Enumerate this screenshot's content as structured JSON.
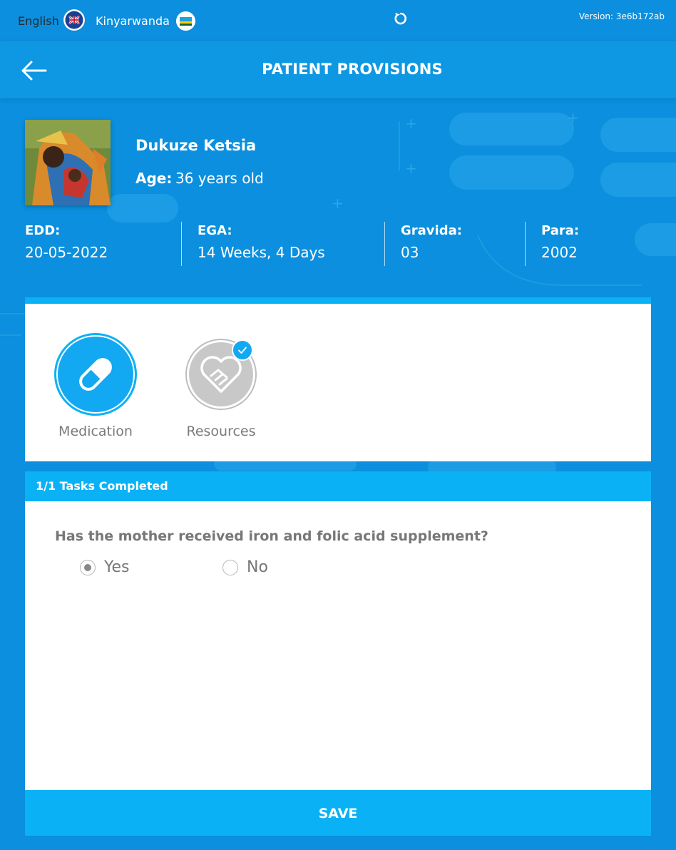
{
  "topbar": {
    "lang_english": "English",
    "lang_kinyarwanda": "Kinyarwanda",
    "version": "Version: 3e6b172ab"
  },
  "header": {
    "title": "PATIENT PROVISIONS"
  },
  "patient": {
    "name": "Dukuze Ketsia",
    "age_label": "Age:",
    "age_value": "36 years old",
    "stats": [
      {
        "key": "EDD:",
        "value": "20-05-2022"
      },
      {
        "key": "EGA:",
        "value": "14 Weeks, 4 Days"
      },
      {
        "key": "Gravida:",
        "value": "03"
      },
      {
        "key": "Para:",
        "value": "2002"
      }
    ]
  },
  "tabs": [
    {
      "label": "Medication",
      "icon": "pill-icon",
      "active": true
    },
    {
      "label": "Resources",
      "icon": "handshake-heart-icon",
      "completed": true
    }
  ],
  "task": {
    "status": "1/1 Tasks Completed",
    "question": "Has the mother received iron and folic acid supplement?",
    "options": [
      "Yes",
      "No"
    ],
    "selected": "Yes"
  },
  "save_label": "SAVE",
  "colors": {
    "background": "#0b8fde",
    "header": "#0e98e3",
    "accent": "#0ab2f5",
    "text_muted": "#777777"
  }
}
